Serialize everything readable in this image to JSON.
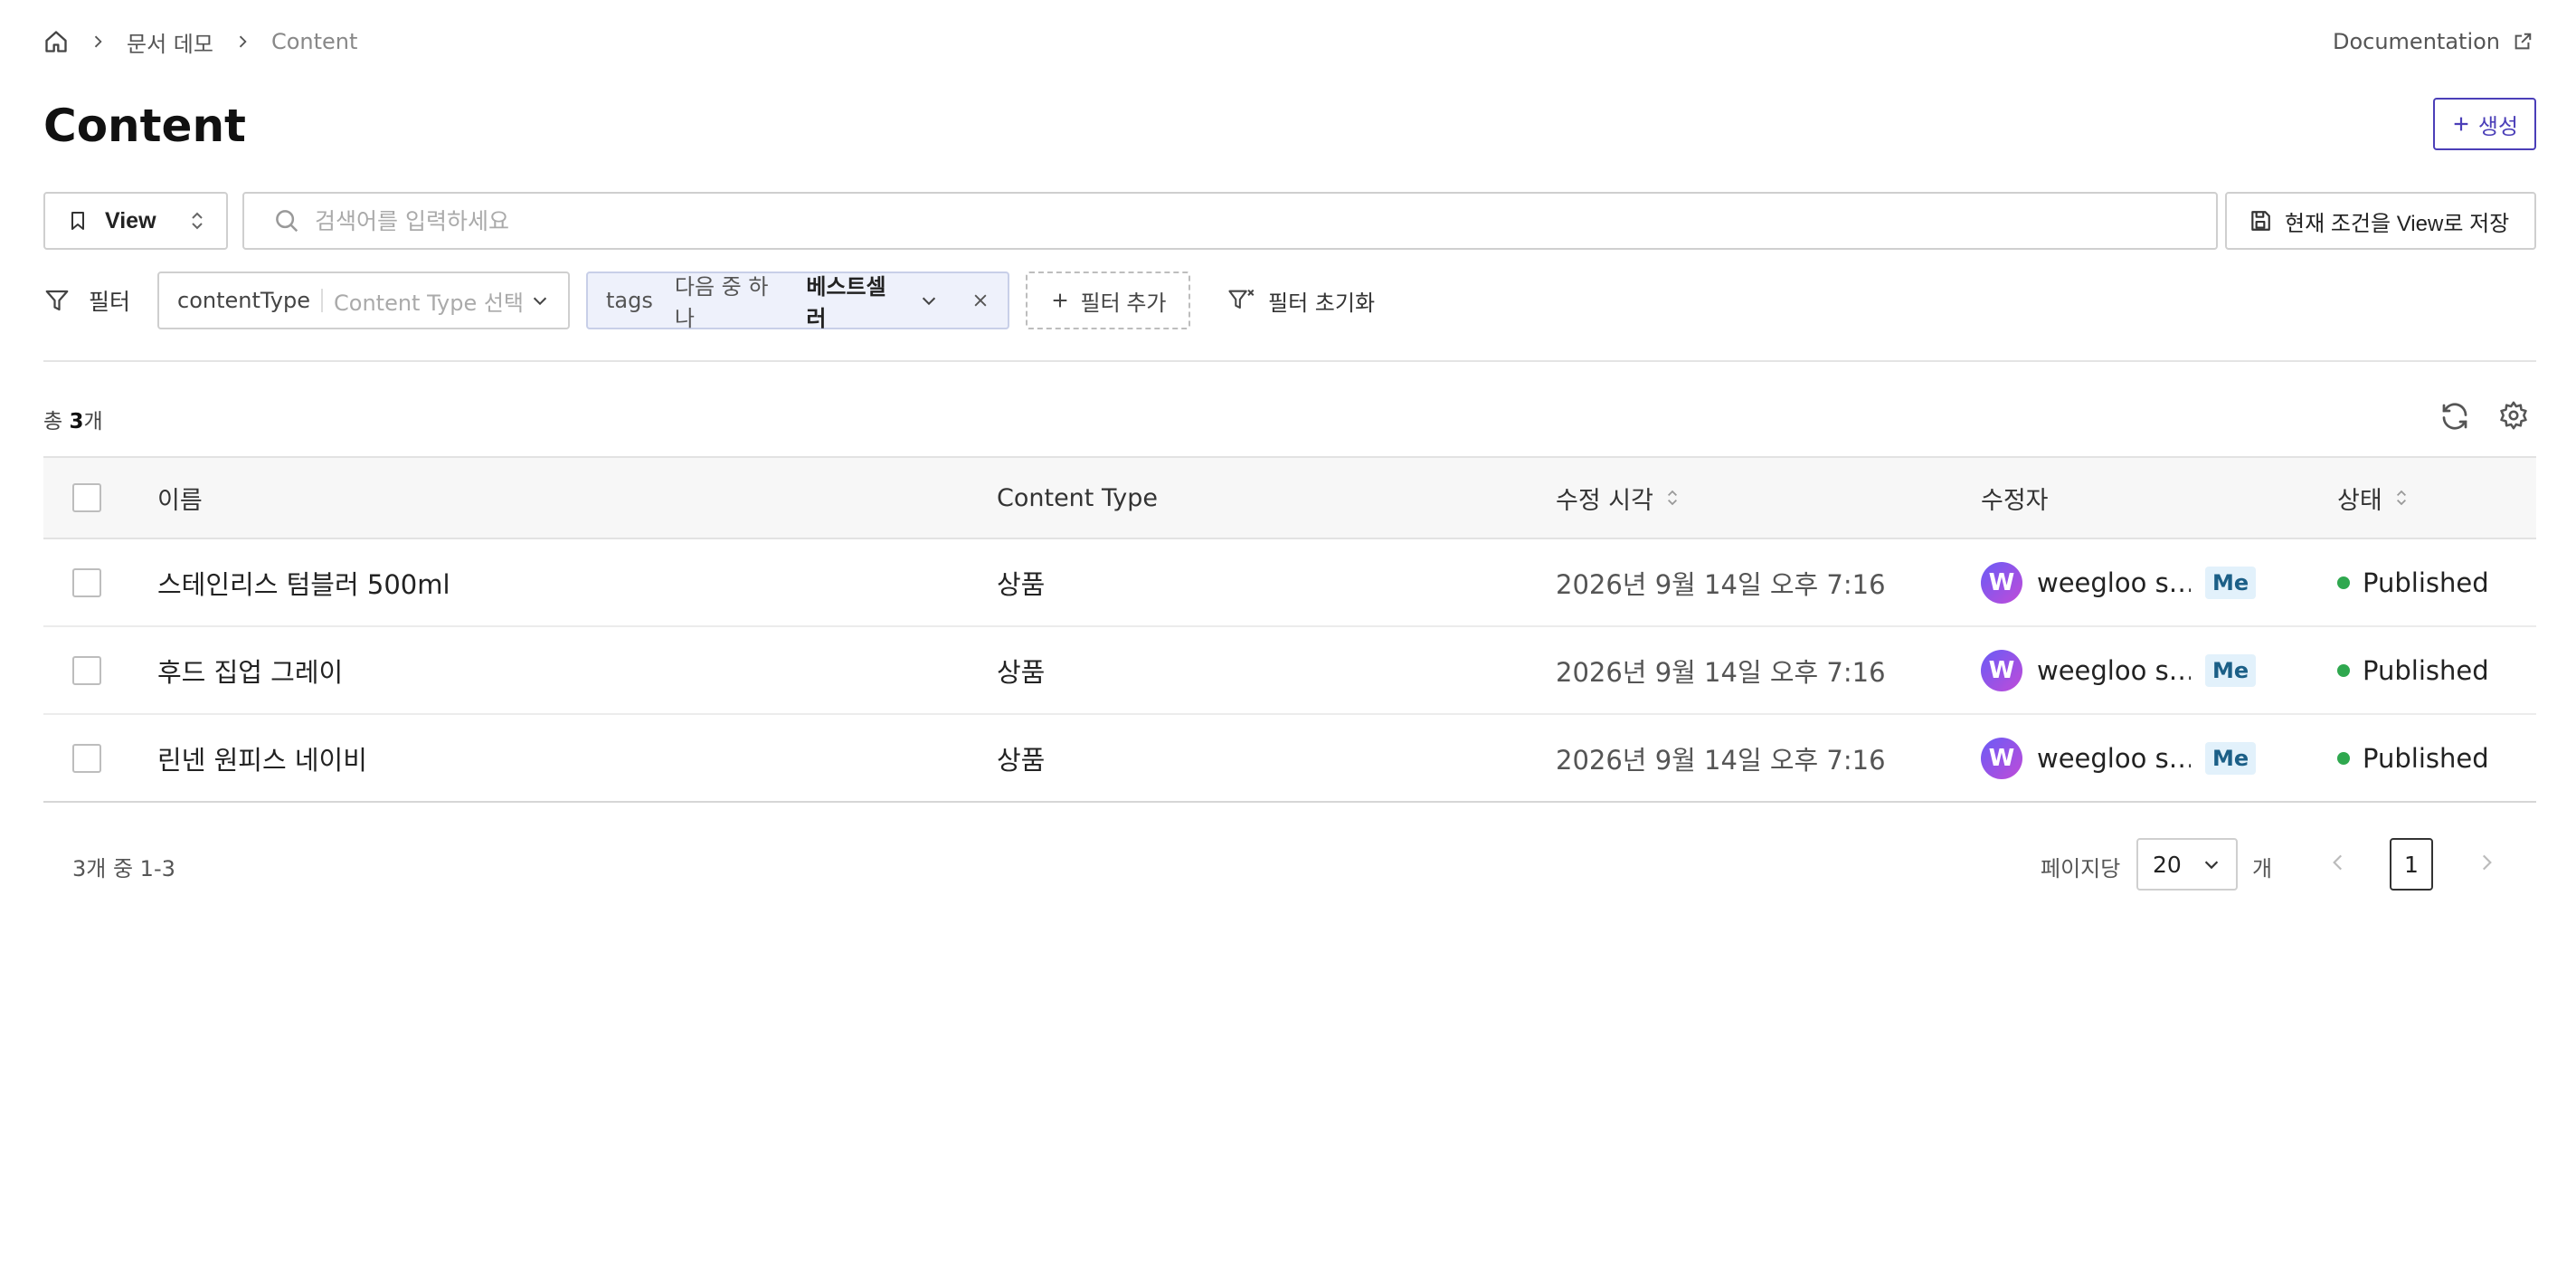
{
  "breadcrumb": {
    "items": [
      "문서 데모",
      "Content"
    ]
  },
  "header": {
    "documentation_label": "Documentation",
    "title": "Content",
    "create_label": "생성"
  },
  "toolbar": {
    "view_label": "View",
    "search_placeholder": "검색어를 입력하세요",
    "search_value": "",
    "save_view_label": "현재 조건을 View로 저장"
  },
  "filters": {
    "label": "필터",
    "content_type": {
      "key": "contentType",
      "placeholder": "Content Type 선택"
    },
    "tags": {
      "key": "tags",
      "operator": "다음 중 하나",
      "value": "베스트셀러"
    },
    "add_label": "필터 추가",
    "reset_label": "필터 초기화"
  },
  "summary": {
    "prefix": "총 ",
    "count": "3",
    "suffix": "개"
  },
  "table": {
    "columns": {
      "name": "이름",
      "content_type": "Content Type",
      "modified_at": "수정 시각",
      "editor": "수정자",
      "status": "상태"
    },
    "rows": [
      {
        "name": "스테인리스 텀블러 500ml",
        "content_type": "상품",
        "modified_at": "2026년 9월 14일 오후 7:16",
        "editor": "weegloo s…",
        "me": "Me",
        "status": "Published"
      },
      {
        "name": "후드 집업 그레이",
        "content_type": "상품",
        "modified_at": "2026년 9월 14일 오후 7:16",
        "editor": "weegloo s…",
        "me": "Me",
        "status": "Published"
      },
      {
        "name": "린넨 원피스 네이비",
        "content_type": "상품",
        "modified_at": "2026년 9월 14일 오후 7:16",
        "editor": "weegloo s…",
        "me": "Me",
        "status": "Published"
      }
    ]
  },
  "pagination": {
    "range_label": "3개 중 1-3",
    "per_page_label": "페이지당",
    "per_page_value": "20",
    "per_page_unit": "개",
    "current_page": "1"
  },
  "colors": {
    "accent": "#4b3fb8",
    "published": "#2fa84f",
    "me_badge_bg": "#e2f1fb",
    "tags_chip_bg": "#eef1fb"
  },
  "icons": [
    "home-icon",
    "chevron-right-icon",
    "external-link-icon",
    "plus-icon",
    "bookmark-icon",
    "sort-icon",
    "search-icon",
    "save-icon",
    "filter-icon",
    "chevron-down-icon",
    "close-icon",
    "filter-reset-icon",
    "refresh-icon",
    "gear-icon",
    "chevron-left-icon"
  ]
}
